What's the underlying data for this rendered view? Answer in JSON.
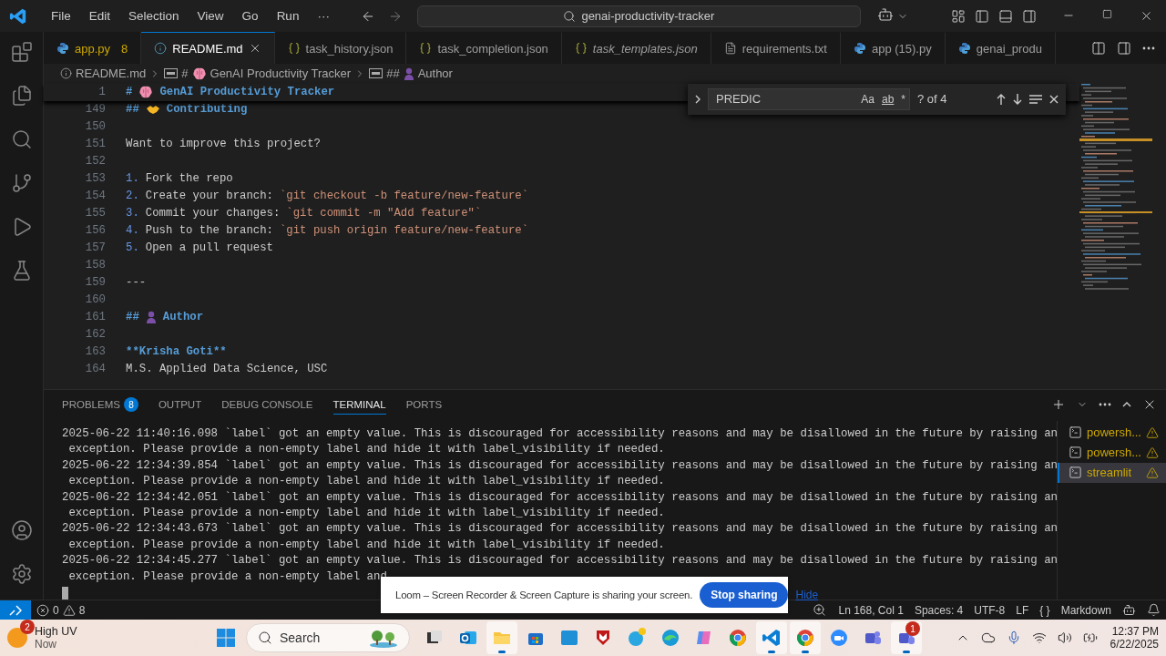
{
  "menu": [
    "File",
    "Edit",
    "Selection",
    "View",
    "Go",
    "Run",
    "···"
  ],
  "command_center": "genai-productivity-tracker",
  "tabs": [
    {
      "label": "app.py",
      "kind": "python",
      "selected": false,
      "preview": false,
      "badge": "8"
    },
    {
      "label": "README.md",
      "kind": "info",
      "selected": true,
      "preview": false
    },
    {
      "label": "task_history.json",
      "kind": "json",
      "selected": false,
      "preview": false
    },
    {
      "label": "task_completion.json",
      "kind": "json",
      "selected": false,
      "preview": false
    },
    {
      "label": "task_templates.json",
      "kind": "json",
      "selected": false,
      "preview": true
    },
    {
      "label": "requirements.txt",
      "kind": "text",
      "selected": false,
      "preview": false
    },
    {
      "label": "app (15).py",
      "kind": "python",
      "selected": false,
      "preview": false
    },
    {
      "label": "genai_produ",
      "kind": "python",
      "selected": false,
      "preview": false
    }
  ],
  "breadcrumbs": [
    {
      "kind": "info",
      "text": "README.md"
    },
    {
      "kind": "heading",
      "marker": "#",
      "text": "GenAI Productivity Tracker"
    },
    {
      "kind": "heading",
      "marker": "##",
      "text": "Author"
    }
  ],
  "editor": {
    "lines": [
      {
        "number": "1",
        "sticky": true,
        "segments": [
          {
            "kind": "heading",
            "text": "#"
          },
          {
            "kind": "brain"
          },
          {
            "kind": "heading",
            "text": "GenAI Productivity Tracker"
          }
        ]
      },
      {
        "number": "149",
        "segments": [
          {
            "kind": "heading",
            "text": "##"
          },
          {
            "kind": "handshake"
          },
          {
            "kind": "heading",
            "text": "Contributing"
          }
        ]
      },
      {
        "number": "150"
      },
      {
        "number": "151",
        "segments": [
          {
            "kind": "plain",
            "text": "Want to improve this project?"
          }
        ]
      },
      {
        "number": "152"
      },
      {
        "number": "153",
        "segments": [
          {
            "kind": "list",
            "text": "1."
          },
          {
            "kind": "plain",
            "text": "Fork the repo"
          }
        ]
      },
      {
        "number": "154",
        "segments": [
          {
            "kind": "list",
            "text": "2."
          },
          {
            "kind": "plain",
            "text": "Create your branch:"
          },
          {
            "kind": "code",
            "text": "`git checkout -b feature/new-feature`"
          }
        ]
      },
      {
        "number": "155",
        "segments": [
          {
            "kind": "list",
            "text": "3."
          },
          {
            "kind": "plain",
            "text": "Commit your changes:"
          },
          {
            "kind": "code",
            "text": "`git commit -m \"Add feature\"`"
          }
        ]
      },
      {
        "number": "156",
        "segments": [
          {
            "kind": "list",
            "text": "4."
          },
          {
            "kind": "plain",
            "text": "Push to the branch:"
          },
          {
            "kind": "code",
            "text": "`git push origin feature/new-feature`"
          }
        ]
      },
      {
        "number": "157",
        "segments": [
          {
            "kind": "list",
            "text": "5."
          },
          {
            "kind": "plain",
            "text": "Open a pull request"
          }
        ]
      },
      {
        "number": "158"
      },
      {
        "number": "159",
        "segments": [
          {
            "kind": "rule",
            "text": "---"
          }
        ]
      },
      {
        "number": "160"
      },
      {
        "number": "161",
        "segments": [
          {
            "kind": "heading",
            "text": "##"
          },
          {
            "kind": "person"
          },
          {
            "kind": "heading",
            "text": "Author"
          }
        ]
      },
      {
        "number": "162"
      },
      {
        "number": "163",
        "segments": [
          {
            "kind": "bold",
            "text": "**Krisha Goti**"
          }
        ]
      },
      {
        "number": "164",
        "segments": [
          {
            "kind": "plain",
            "text": "M.S. Applied Data Science, USC"
          }
        ]
      }
    ]
  },
  "find": {
    "value": "PREDIC",
    "options": [
      "Aa",
      "ab",
      "*"
    ],
    "count": "? of 4"
  },
  "panel": {
    "tabs": [
      {
        "label": "PROBLEMS",
        "badge": "8",
        "selected": false
      },
      {
        "label": "OUTPUT",
        "selected": false
      },
      {
        "label": "DEBUG CONSOLE",
        "selected": false
      },
      {
        "label": "TERMINAL",
        "selected": true
      },
      {
        "label": "PORTS",
        "selected": false
      }
    ],
    "terminal_lines": [
      "2025-06-22 11:40:16.098 `label` got an empty value. This is discouraged for accessibility reasons and may be disallowed in the future by raising an",
      " exception. Please provide a non-empty label and hide it with label_visibility if needed.",
      "2025-06-22 12:34:39.854 `label` got an empty value. This is discouraged for accessibility reasons and may be disallowed in the future by raising an",
      " exception. Please provide a non-empty label and hide it with label_visibility if needed.",
      "2025-06-22 12:34:42.051 `label` got an empty value. This is discouraged for accessibility reasons and may be disallowed in the future by raising an",
      " exception. Please provide a non-empty label and hide it with label_visibility if needed.",
      "2025-06-22 12:34:43.673 `label` got an empty value. This is discouraged for accessibility reasons and may be disallowed in the future by raising an",
      " exception. Please provide a non-empty label and hide it with label_visibility if needed.",
      "2025-06-22 12:34:45.277 `label` got an empty value. This is discouraged for accessibility reasons and may be disallowed in the future by raising an",
      " exception. Please provide a non-empty label and"
    ],
    "sessions": [
      {
        "label": "powersh...",
        "selected": false
      },
      {
        "label": "powersh...",
        "selected": false
      },
      {
        "label": "streamlit",
        "selected": true
      }
    ]
  },
  "status_bar": {
    "errors": "0",
    "warnings": "8",
    "right": [
      "Ln 168, Col 1",
      "Spaces: 4",
      "UTF-8",
      "LF",
      "{ }",
      "Markdown"
    ]
  },
  "loom": {
    "message": "Loom – Screen Recorder & Screen Capture is sharing your screen.",
    "button": "Stop sharing",
    "link": "Hide"
  },
  "taskbar": {
    "weather": {
      "badge": "2",
      "title": "High UV",
      "subtitle": "Now"
    },
    "search": "Search",
    "apps": [
      {
        "kind": "files",
        "active": false
      },
      {
        "kind": "outlook",
        "active": false
      },
      {
        "kind": "folder",
        "active": true
      },
      {
        "kind": "store",
        "active": false
      },
      {
        "kind": "hp",
        "active": false
      },
      {
        "kind": "shield",
        "active": false
      },
      {
        "kind": "help",
        "active": false
      },
      {
        "kind": "edge",
        "active": false
      },
      {
        "kind": "copilot",
        "active": false
      },
      {
        "kind": "chrome",
        "active": false
      },
      {
        "kind": "vscode",
        "active": true
      },
      {
        "kind": "chrome",
        "active": true
      },
      {
        "kind": "zoom",
        "active": false
      },
      {
        "kind": "teams",
        "active": false
      },
      {
        "kind": "teams",
        "active": true,
        "badge": "1"
      }
    ],
    "time": "12:37 PM",
    "date": "6/22/2025"
  }
}
